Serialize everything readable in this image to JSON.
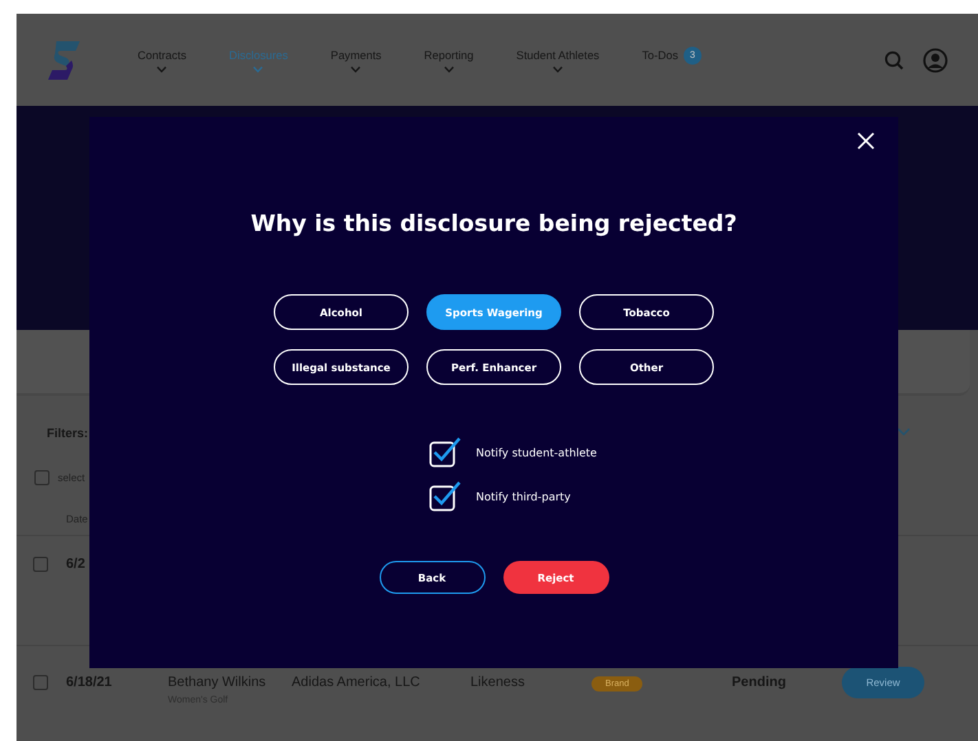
{
  "header": {
    "nav": [
      {
        "label": "Contracts",
        "selected": false
      },
      {
        "label": "Disclosures",
        "selected": true
      },
      {
        "label": "Payments",
        "selected": false
      },
      {
        "label": "Reporting",
        "selected": false
      },
      {
        "label": "Student Athletes",
        "selected": false
      },
      {
        "label": "To-Dos",
        "selected": false,
        "badge": "3"
      }
    ]
  },
  "background": {
    "filters_label": "Filters:",
    "select_label": "select",
    "select_all_checked": false,
    "date_heading": "Date",
    "rows": [
      {
        "date": "6/2",
        "checked": false
      },
      {
        "date": "6/18/21",
        "checked": false,
        "athlete": "Bethany Wilkins",
        "sport": "Women's Golf",
        "company": "Adidas America, LLC",
        "type": "Likeness",
        "tag": "Brand",
        "status": "Pending",
        "action": "Review"
      }
    ]
  },
  "modal": {
    "title": "Why is this disclosure being rejected?",
    "reasons": [
      {
        "label": "Alcohol",
        "selected": false
      },
      {
        "label": "Sports Wagering",
        "selected": true
      },
      {
        "label": "Tobacco",
        "selected": false
      },
      {
        "label": "Illegal substance",
        "selected": false
      },
      {
        "label": "Perf. Enhancer",
        "selected": false
      },
      {
        "label": "Other",
        "selected": false
      }
    ],
    "notifications": [
      {
        "label": "Notify student-athlete",
        "checked": true
      },
      {
        "label": "Notify third-party",
        "checked": true
      }
    ],
    "buttons": [
      {
        "label": "Back",
        "kind": "secondary"
      },
      {
        "label": "Reject",
        "kind": "primary"
      }
    ]
  }
}
